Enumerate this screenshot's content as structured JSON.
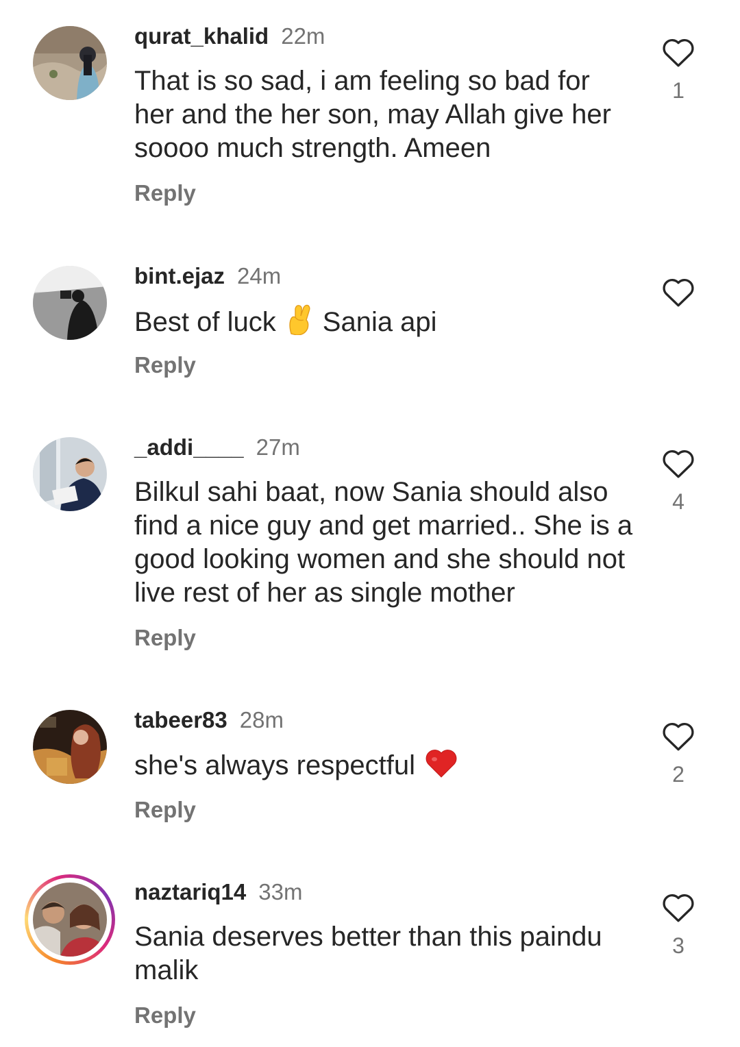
{
  "comments": [
    {
      "username": "qurat_khalid",
      "time": "22m",
      "text": "That is so sad, i am feeling so bad for her and the her son, may Allah give her soooo much strength. Ameen",
      "reply_label": "Reply",
      "likes": "1"
    },
    {
      "username": "bint.ejaz",
      "time": "24m",
      "text_before": "Best of luck",
      "emoji": "crossed-fingers-emoji",
      "text_after": "Sania api",
      "reply_label": "Reply",
      "likes": ""
    },
    {
      "username": "_addi____",
      "time": "27m",
      "text": "Bilkul sahi baat, now Sania should also find a nice guy and get married.. She is a good looking women and she should not live rest of her as single mother",
      "reply_label": "Reply",
      "likes": "4"
    },
    {
      "username": "tabeer83",
      "time": "28m",
      "text": "she's always respectful",
      "emoji": "red-heart-emoji",
      "reply_label": "Reply",
      "likes": "2"
    },
    {
      "username": "naztariq14",
      "time": "33m",
      "text": "Sania deserves better than this paindu malik",
      "reply_label": "Reply",
      "likes": "3",
      "story_ring": true
    }
  ],
  "colors": {
    "text": "#262626",
    "secondary": "#737373",
    "heart_outline": "#262626",
    "story_ring": [
      "#f58529",
      "#dd2a7b",
      "#8134af"
    ]
  },
  "icons": {
    "like": "heart-outline-icon"
  }
}
